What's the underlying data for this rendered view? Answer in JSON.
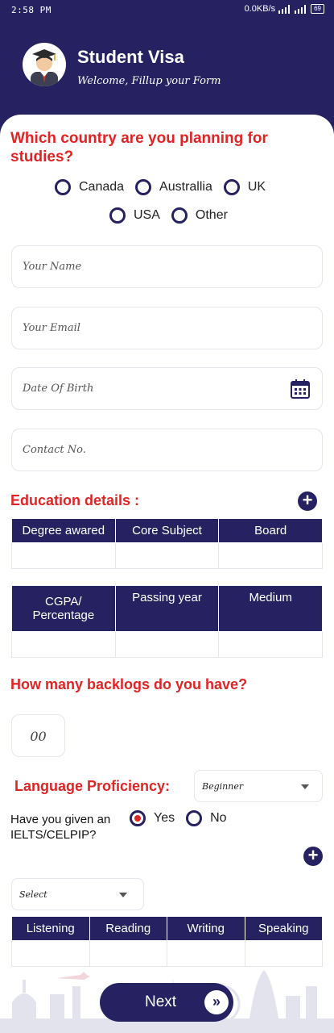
{
  "status_bar": {
    "time": "2:58 PM",
    "network_speed": "0.0KB/s",
    "battery": "69"
  },
  "header": {
    "title": "Student Visa",
    "subtitle": "Welcome, Fillup your Form"
  },
  "country_question": {
    "text": "Which country are you planning for studies?",
    "options": [
      "Canada",
      "Australlia",
      "UK",
      "USA",
      "Other"
    ]
  },
  "fields": {
    "name_placeholder": "Your Name",
    "email_placeholder": "Your Email",
    "dob_placeholder": "Date Of Birth",
    "contact_placeholder": "Contact No."
  },
  "education": {
    "title": "Education details :",
    "headers_1": [
      "Degree awared",
      "Core Subject",
      "Board"
    ],
    "headers_2": [
      "CGPA/ Percentage",
      "Passing year",
      "Medium"
    ]
  },
  "backlogs": {
    "question": "How many backlogs do you have?",
    "value": "00"
  },
  "language": {
    "title": "Language Proficiency:",
    "level_selected": "Beginner",
    "ielts_question": "Have you given an IELTS/CELPIP?",
    "yes_label": "Yes",
    "no_label": "No",
    "yes_selected": true,
    "test_select": "Select",
    "score_headers": [
      "Listening",
      "Reading",
      "Writing",
      "Speaking"
    ]
  },
  "next_button": {
    "label": "Next",
    "arrow": "»"
  },
  "colors": {
    "primary": "#262262",
    "accent": "#e02424"
  }
}
